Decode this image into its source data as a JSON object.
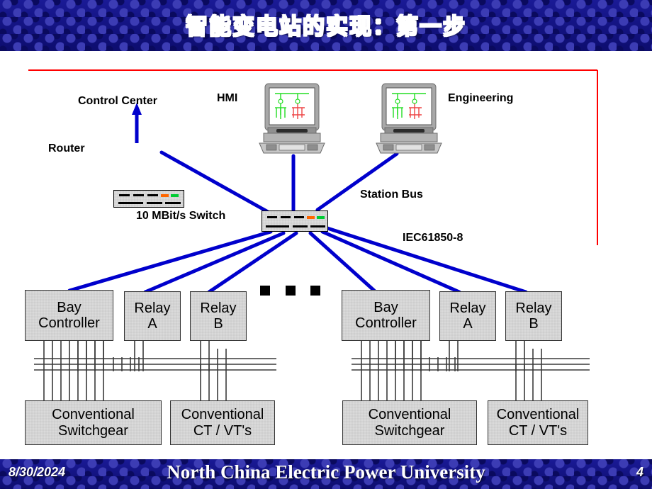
{
  "slide": {
    "title": "智能变电站的实现：第一步",
    "footer": {
      "date": "8/30/2024",
      "organization": "North China Electric Power University",
      "page_number": "4"
    },
    "colors": {
      "band_blue": "#151585",
      "link_blue": "#0000cc",
      "border_red": "#ff0000",
      "box_gray": "#d4d4d4",
      "led_orange": "#ff6600",
      "led_green": "#00cc33"
    }
  },
  "diagram": {
    "labels": {
      "control_center": "Control Center",
      "router": "Router",
      "hmi": "HMI",
      "engineering": "Engineering",
      "station_bus": "Station Bus",
      "switch": "10 MBit/s Switch",
      "protocol": "IEC61850-8"
    },
    "devices": {
      "router": "router-device",
      "switch": "switch-device",
      "hmi_workstation": "hmi-workstation",
      "engineering_workstation": "engineering-workstation"
    },
    "bay_groups": [
      {
        "id": "bay-group-left",
        "ieds": [
          {
            "line1": "Bay",
            "line2": "Controller"
          },
          {
            "line1": "Relay",
            "line2": "A"
          },
          {
            "line1": "Relay",
            "line2": "B"
          }
        ],
        "primary": [
          {
            "line1": "Conventional",
            "line2": "Switchgear"
          },
          {
            "line1": "Conventional",
            "line2": "CT / VT's"
          }
        ]
      },
      {
        "id": "bay-group-right",
        "ieds": [
          {
            "line1": "Bay",
            "line2": "Controller"
          },
          {
            "line1": "Relay",
            "line2": "A"
          },
          {
            "line1": "Relay",
            "line2": "B"
          }
        ],
        "primary": [
          {
            "line1": "Conventional",
            "line2": "Switchgear"
          },
          {
            "line1": "Conventional",
            "line2": "CT / VT's"
          }
        ]
      }
    ],
    "ellipsis": "■ ■ ■"
  }
}
